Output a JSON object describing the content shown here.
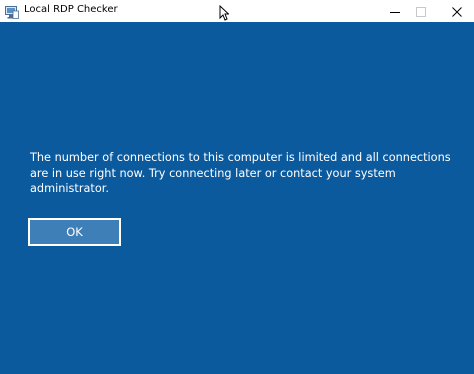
{
  "window": {
    "title": "Local RDP Checker",
    "icon": "rdp-app-icon",
    "controls": {
      "minimize_icon": "minimize-icon",
      "maximize_icon": "maximize-icon",
      "close_icon": "close-icon"
    }
  },
  "dialog": {
    "message": "The number of connections to this computer is limited and all connections are in use right now. Try connecting later or contact your system administrator.",
    "ok_label": "OK"
  },
  "colors": {
    "background": "#0b5a9e",
    "button_fill": "#3f7fb7",
    "text": "#ffffff"
  }
}
